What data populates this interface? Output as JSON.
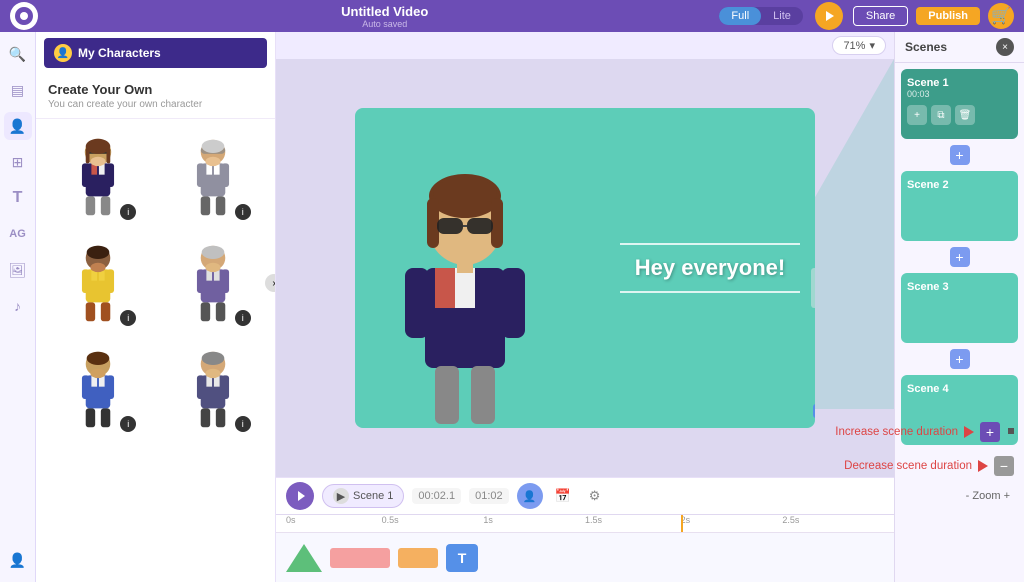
{
  "topbar": {
    "title": "Untitled Video",
    "subtitle": "Auto saved",
    "mode_full": "Full",
    "mode_lite": "Lite",
    "share_label": "Share",
    "publish_label": "Publish"
  },
  "char_panel": {
    "header_label": "My Characters",
    "create_title": "Create Your Own",
    "create_sub": "You can create your own character",
    "expand_icon": "›",
    "characters": [
      {
        "id": 1,
        "badge": "i"
      },
      {
        "id": 2,
        "badge": "i"
      },
      {
        "id": 3,
        "badge": "i"
      },
      {
        "id": 4,
        "badge": "i"
      },
      {
        "id": 5,
        "badge": "i"
      },
      {
        "id": 6,
        "badge": "i"
      }
    ]
  },
  "canvas": {
    "zoom_label": "71%",
    "scene_text": "Hey everyone!",
    "zoom_chevron": "▾"
  },
  "timeline": {
    "scene_label": "Scene 1",
    "time_current": "00:02.1",
    "time_total": "01:02",
    "ruler_marks": [
      "0s",
      "0.5s",
      "1s",
      "1.5s",
      "2s",
      "2.5s"
    ],
    "text_block_label": "T"
  },
  "scenes_panel": {
    "title": "Scenes",
    "close_icon": "×",
    "add_icon": "+",
    "scenes": [
      {
        "label": "Scene 1",
        "time": "00:03",
        "active": true
      },
      {
        "label": "Scene 2",
        "active": false
      },
      {
        "label": "Scene 3",
        "active": false
      },
      {
        "label": "Scene 4",
        "active": false
      }
    ]
  },
  "annotations": {
    "increase_label": "Increase scene duration",
    "decrease_label": "Decrease scene duration",
    "zoom_label": "- Zoom +"
  }
}
